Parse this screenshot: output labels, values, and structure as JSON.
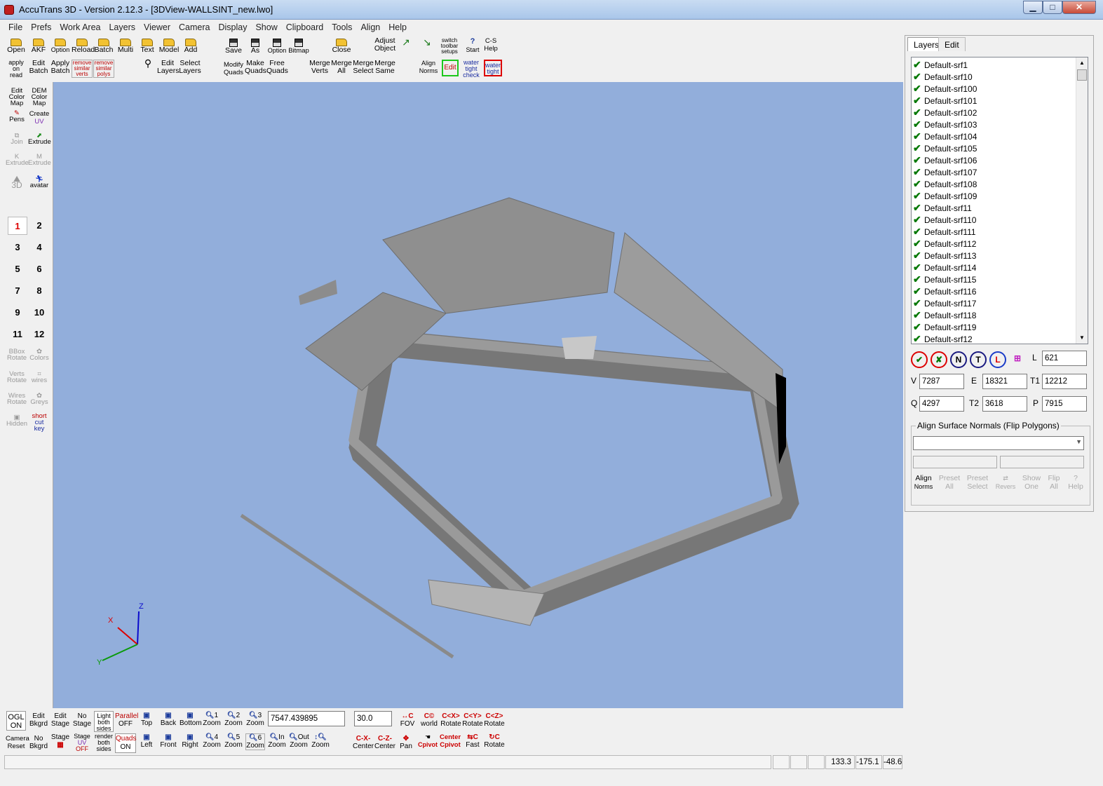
{
  "window": {
    "title": "AccuTrans 3D - Version 2.12.3 - [3DView-WALLSINT_new.lwo]",
    "min_glyph": "▁",
    "max_glyph": "□",
    "close_glyph": "✕"
  },
  "menu": [
    "File",
    "Prefs",
    "Work Area",
    "Layers",
    "Viewer",
    "Camera",
    "Display",
    "Show",
    "Clipboard",
    "Tools",
    "Align",
    "Help"
  ],
  "toolbar": {
    "open": "Open",
    "akf": "AKF",
    "option": "Option",
    "reload": "Reload",
    "batch": "Batch",
    "multi": "Multi",
    "text": "Text",
    "model": "Model",
    "add": "Add",
    "save": "Save",
    "as": "As",
    "option2": "Option",
    "bitmap": "Bitmap",
    "close": "Close",
    "adjust": "Adjust",
    "object": "Object",
    "switch1": "switch",
    "switch2": "toolbar",
    "switch3": "setups",
    "cs": "C-S",
    "help": "Help",
    "start": "Start",
    "apply1": "apply",
    "apply2": "on",
    "apply3": "read",
    "edit_batch1": "Edit",
    "edit_batch2": "Batch",
    "apply_batch1": "Apply",
    "apply_batch2": "Batch",
    "rsv1": "remove",
    "rsv2": "similar",
    "rsv3": "verts",
    "rsp1": "remove",
    "rsp2": "similar",
    "rsp3": "polys",
    "edit_layers1": "Edit",
    "edit_layers2": "Layers",
    "select_layers1": "Select",
    "select_layers2": "Layers",
    "modify1": "Modify",
    "modify2": "Quads",
    "make1": "Make",
    "make2": "Quads",
    "free1": "Free",
    "free2": "Quads",
    "mv1": "Merge",
    "mv2": "Verts",
    "ma1": "Merge",
    "ma2": "All",
    "msel1": "Merge",
    "msel2": "Select",
    "msame1": "Merge",
    "msame2": "Same",
    "an1": "Align",
    "an2": "Norms",
    "edit": "Edit",
    "wt1": "water",
    "wt2": "tight",
    "wt3": "check",
    "wt4": "water",
    "wt5": "tight"
  },
  "lefttools": {
    "ecm1": "Edit",
    "ecm2": "Color",
    "ecm3": "Map",
    "dem1": "DEM",
    "dem2": "Color",
    "dem3": "Map",
    "pens": "Pens",
    "create1": "Create",
    "create2": "UV",
    "join": "Join",
    "extrude": "Extrude",
    "kext": "Extrude",
    "mext": "Extrude",
    "k": "K",
    "m": "M",
    "to3d": "3D",
    "avatar": "avatar",
    "bbox1": "BBox",
    "bbox2": "Rotate",
    "colors": "Colors",
    "verts1": "Verts",
    "verts2": "Rotate",
    "wires": "wires",
    "wires1": "Wires",
    "wires2": "Rotate",
    "greys": "Greys",
    "hidden": "Hidden",
    "sck1": "short",
    "sck2": "cut",
    "sck3": "key"
  },
  "numbers": [
    "1",
    "2",
    "3",
    "4",
    "5",
    "6",
    "7",
    "8",
    "9",
    "10",
    "11",
    "12"
  ],
  "axes": {
    "x": "X",
    "y": "Y",
    "z": "Z"
  },
  "bottom": {
    "ogl1": "OGL",
    "ogl2": "ON",
    "eb1": "Edit",
    "eb2": "Bkgrd",
    "es1": "Edit",
    "es2": "Stage",
    "ns1": "No",
    "ns2": "Stage",
    "lb1": "Light",
    "lb2": "both",
    "lb3": "sides",
    "par1": "Parallel",
    "par2": "OFF",
    "top": "Top",
    "back": "Back",
    "bottom": "Bottom",
    "z1": "1",
    "z2": "2",
    "z3": "3",
    "z4": "4",
    "z5": "5",
    "z6": "6",
    "zin": "In",
    "zout": "Out",
    "zoom": "Zoom",
    "zoom_value": "7547.439895",
    "angle_value": "30.0",
    "fov": "FOV",
    "world": "world",
    "rot": "Rotate",
    "cx": "C<X>",
    "cy": "C<Y>",
    "cz": "C<Z>",
    "cr1": "Camera",
    "cr2": "Reset",
    "nb1": "No",
    "nb2": "Bkgrd",
    "sg1": "Stage",
    "su1": "Stage",
    "su2": "UV",
    "su3": "OFF",
    "rb1": "render",
    "rb2": "both",
    "rb3": "sides",
    "q1": "Quads",
    "q2": "ON",
    "left": "Left",
    "front": "Front",
    "right": "Right",
    "cxc": "C-X-",
    "czc": "C-Z-",
    "center": "Center",
    "pan": "Pan",
    "cpivot": "Cpivot",
    "center2": "Center",
    "fast": "Fast",
    "rotate2": "Rotate"
  },
  "status": {
    "a": "133.3",
    "b": "-175.1",
    "c": "-48.6"
  },
  "panel": {
    "tab_layers": "Layers",
    "tab_edit": "Edit",
    "layers": [
      "Default-srf1",
      "Default-srf10",
      "Default-srf100",
      "Default-srf101",
      "Default-srf102",
      "Default-srf103",
      "Default-srf104",
      "Default-srf105",
      "Default-srf106",
      "Default-srf107",
      "Default-srf108",
      "Default-srf109",
      "Default-srf11",
      "Default-srf110",
      "Default-srf111",
      "Default-srf112",
      "Default-srf113",
      "Default-srf114",
      "Default-srf115",
      "Default-srf116",
      "Default-srf117",
      "Default-srf118",
      "Default-srf119",
      "Default-srf12"
    ],
    "n": "N",
    "t": "T",
    "L_label": "L",
    "L": "621",
    "V_label": "V",
    "V": "7287",
    "E_label": "E",
    "E": "18321",
    "T1_label": "T1",
    "T1": "12212",
    "Q_label": "Q",
    "Q": "4297",
    "T2_label": "T2",
    "T2": "3618",
    "P_label": "P",
    "P": "7915",
    "align_title": "Align Surface Normals (Flip Polygons)",
    "an1": "Align",
    "an2": "Norms",
    "pa1": "Preset",
    "pa2": "All",
    "ps1": "Preset",
    "ps2": "Select",
    "rev": "Revers",
    "so1": "Show",
    "so2": "One",
    "fa1": "Flip",
    "fa2": "All",
    "help": "Help"
  }
}
